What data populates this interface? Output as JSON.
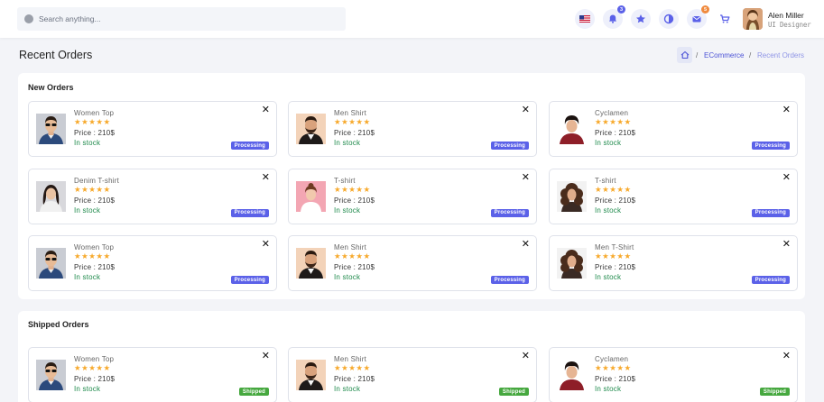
{
  "header": {
    "search_placeholder": "Search anything...",
    "notifications_count": "3",
    "messages_count": "5",
    "user_name": "Alen Miller",
    "user_role": "UI Designer",
    "icons": [
      "us-flag-icon",
      "bell-icon",
      "star-icon",
      "theme-toggle-icon",
      "mail-icon",
      "cart-icon"
    ],
    "badge_colors": {
      "notifications": "#5b61e8",
      "messages": "#f08a3e"
    }
  },
  "page": {
    "title": "Recent Orders",
    "breadcrumb": {
      "parent": "ECommerce",
      "current": "Recent Orders",
      "separator": "/"
    }
  },
  "sections": [
    {
      "title": "New Orders",
      "status_color": "#5b61e8",
      "orders": [
        {
          "name": "Women Top",
          "stars": "★★★★★",
          "price": "Price : 210$",
          "stock": "In stock",
          "status": "Processing",
          "thumb": "man-sunglasses"
        },
        {
          "name": "Men Shirt",
          "stars": "★★★★★",
          "price": "Price : 210$",
          "stock": "In stock",
          "status": "Processing",
          "thumb": "man-beard"
        },
        {
          "name": "Cyclamen",
          "stars": "★★★★★",
          "price": "Price : 210$",
          "stock": "In stock",
          "status": "Processing",
          "thumb": "man-red"
        },
        {
          "name": "Denim T-shirt",
          "stars": "★★★★★",
          "price": "Price : 210$",
          "stock": "In stock",
          "status": "Processing",
          "thumb": "woman-gray"
        },
        {
          "name": "T-shirt",
          "stars": "★★★★★",
          "price": "Price : 210$",
          "stock": "In stock",
          "status": "Processing",
          "thumb": "woman-pink"
        },
        {
          "name": "T-shirt",
          "stars": "★★★★★",
          "price": "Price : 210$",
          "stock": "In stock",
          "status": "Processing",
          "thumb": "woman-curly"
        },
        {
          "name": "Women Top",
          "stars": "★★★★★",
          "price": "Price : 210$",
          "stock": "In stock",
          "status": "Processing",
          "thumb": "man-sunglasses"
        },
        {
          "name": "Men Shirt",
          "stars": "★★★★★",
          "price": "Price : 210$",
          "stock": "In stock",
          "status": "Processing",
          "thumb": "man-beard"
        },
        {
          "name": "Men T-Shirt",
          "stars": "★★★★★",
          "price": "Price : 210$",
          "stock": "In stock",
          "status": "Processing",
          "thumb": "woman-curly"
        }
      ]
    },
    {
      "title": "Shipped Orders",
      "status_color": "#46a83f",
      "orders": [
        {
          "name": "Women Top",
          "stars": "★★★★★",
          "price": "Price : 210$",
          "stock": "In stock",
          "status": "Shipped",
          "thumb": "man-sunglasses"
        },
        {
          "name": "Men Shirt",
          "stars": "★★★★★",
          "price": "Price : 210$",
          "stock": "In stock",
          "status": "Shipped",
          "thumb": "man-beard"
        },
        {
          "name": "Cyclamen",
          "stars": "★★★★★",
          "price": "Price : 210$",
          "stock": "In stock",
          "status": "Shipped",
          "thumb": "man-red"
        }
      ]
    }
  ],
  "colors": {
    "accent": "#5b61e8",
    "star": "#f7a92b",
    "in_stock": "#1f8a4c",
    "breadcrumb_link": "#4b52d6",
    "breadcrumb_current": "#8f95e6"
  }
}
